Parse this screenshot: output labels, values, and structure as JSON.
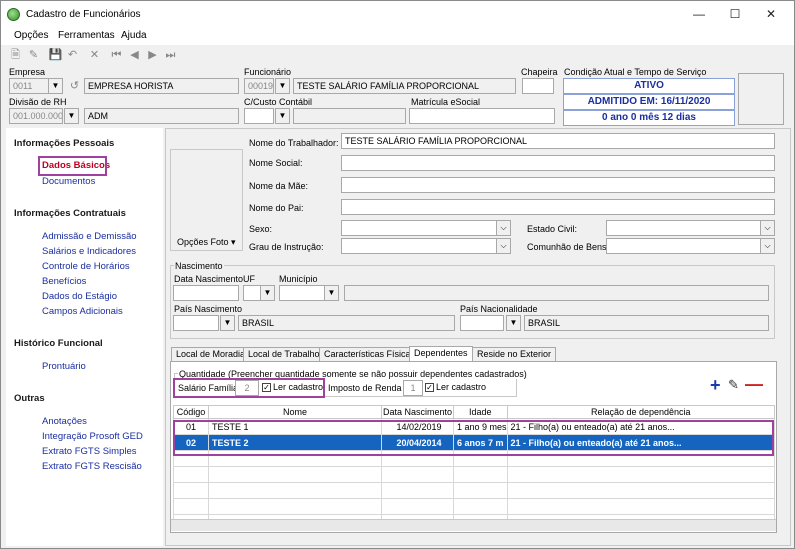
{
  "window": {
    "title": "Cadastro de Funcionários"
  },
  "menu": {
    "items": [
      "Opções",
      "Ferramentas",
      "Ajuda"
    ]
  },
  "header": {
    "empresa_label": "Empresa",
    "empresa_code": "0011",
    "empresa_name": "EMPRESA HORISTA",
    "funcionario_label": "Funcionário",
    "funcionario_code": "00019",
    "funcionario_name": "TESTE SALÁRIO FAMÍLIA PROPORCIONAL",
    "chapeira_label": "Chapeira",
    "condicao_label": "Condição Atual e Tempo de Serviço",
    "status": "ATIVO",
    "admitido": "ADMITIDO EM: 16/11/2020",
    "tempo": "0 ano 0 mês 12 dias",
    "divisao_label": "Divisão de RH",
    "divisao_code": "001.000.000",
    "divisao_name": "ADM",
    "ccusto_label": "C/Custo Contábil",
    "matricula_label": "Matrícula eSocial"
  },
  "sidebar": {
    "sections": [
      {
        "title": "Informações Pessoais",
        "items": [
          "Dados Básicos",
          "Documentos"
        ]
      },
      {
        "title": "Informações Contratuais",
        "items": [
          "Admissão e Demissão",
          "Salários e Indicadores",
          "Controle de Horários",
          "Benefícios",
          "Dados do Estágio",
          "Campos Adicionais"
        ]
      },
      {
        "title": "Histórico Funcional",
        "items": [
          "Prontuário"
        ]
      },
      {
        "title": "Outras",
        "items": [
          "Anotações",
          "Integração Prosoft GED",
          "Extrato FGTS Simples",
          "Extrato FGTS Rescisão"
        ]
      }
    ]
  },
  "form": {
    "opcoes_foto": "Opções Foto",
    "nome_trabalhador_label": "Nome do Trabalhador:",
    "nome_trabalhador": "TESTE SALÁRIO FAMÍLIA PROPORCIONAL",
    "nome_social_label": "Nome Social:",
    "nome_mae_label": "Nome da Mãe:",
    "nome_pai_label": "Nome do Pai:",
    "sexo_label": "Sexo:",
    "estado_civil_label": "Estado Civil:",
    "grau_label": "Grau de Instrução:",
    "comunhao_label": "Comunhão de Bens:",
    "nascimento_label": "Nascimento",
    "data_nasc_label": "Data Nascimento",
    "uf_label": "UF",
    "municipio_label": "Município",
    "pais_nasc_label": "País Nascimento",
    "pais_nasc_value": "BRASIL",
    "pais_nac_label": "País Nacionalidade",
    "pais_nac_value": "BRASIL"
  },
  "tabs": [
    "Local de Moradia",
    "Local de Trabalho",
    "Características Físicas",
    "Dependentes",
    "Reside no Exterior"
  ],
  "dependentes": {
    "quantidade_label": "Quantidade (Preencher quantidade somente se não possuir dependentes cadastrados)",
    "salario_familia_label": "Salário Família",
    "salario_familia_value": "2",
    "ler_cadastro_label": "Ler cadastro",
    "imposto_renda_label": "Imposto de Renda",
    "imposto_renda_value": "1",
    "columns": [
      "Código",
      "Nome",
      "Data Nascimento",
      "Idade",
      "Relação de dependência"
    ],
    "rows": [
      {
        "codigo": "01",
        "nome": "TESTE 1",
        "data": "14/02/2019",
        "idade": "1 ano 9 mes",
        "relacao": "21 - Filho(a) ou enteado(a) até 21 anos..."
      },
      {
        "codigo": "02",
        "nome": "TESTE 2",
        "data": "20/04/2014",
        "idade": "6 anos 7 m",
        "relacao": "21 - Filho(a) ou enteado(a) até 21 anos..."
      }
    ]
  },
  "colors": {
    "accent": "#1565c0",
    "highlight": "#a040a0",
    "link": "#1a2ea0"
  }
}
